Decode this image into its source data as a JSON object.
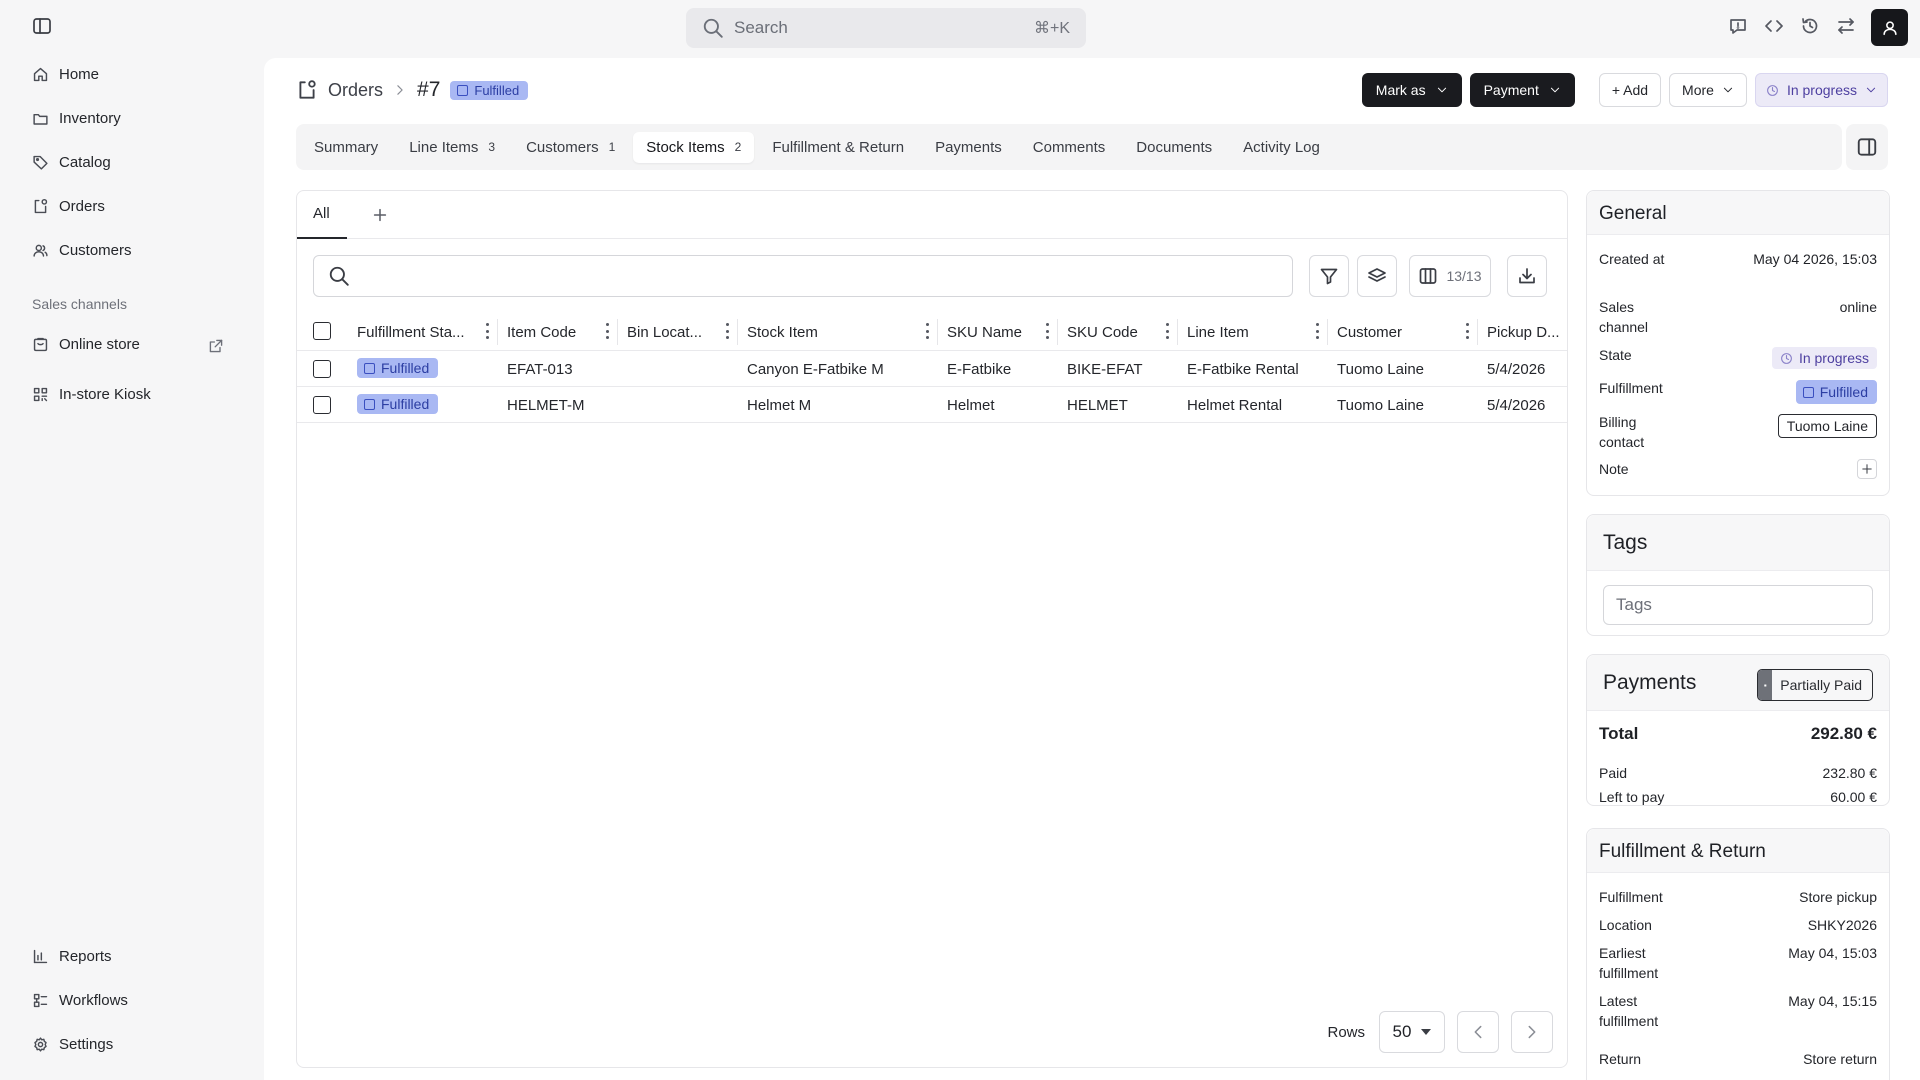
{
  "search": {
    "placeholder": "Search",
    "shortcut": "⌘+K"
  },
  "sidebar": {
    "items": [
      {
        "label": "Home",
        "icon": "home-icon"
      },
      {
        "label": "Inventory",
        "icon": "folder-icon"
      },
      {
        "label": "Catalog",
        "icon": "tag-icon"
      },
      {
        "label": "Orders",
        "icon": "orders-icon"
      },
      {
        "label": "Customers",
        "icon": "users-icon"
      }
    ],
    "section_label": "Sales channels",
    "channels": [
      {
        "label": "Online store",
        "icon": "store-icon"
      },
      {
        "label": "In-store Kiosk",
        "icon": "kiosk-icon"
      }
    ],
    "bottom": [
      {
        "label": "Reports",
        "icon": "chart-icon"
      },
      {
        "label": "Workflows",
        "icon": "workflow-icon"
      },
      {
        "label": "Settings",
        "icon": "gear-icon"
      }
    ]
  },
  "header": {
    "breadcrumb_root": "Orders",
    "order_id": "#7",
    "status": "Fulfilled",
    "actions": {
      "mark_as": "Mark as",
      "payment": "Payment",
      "add": "+ Add",
      "more": "More",
      "state": "In progress"
    }
  },
  "tabs": [
    {
      "label": "Summary",
      "count": ""
    },
    {
      "label": "Line Items",
      "count": "3"
    },
    {
      "label": "Customers",
      "count": "1"
    },
    {
      "label": "Stock Items",
      "count": "2",
      "active": true
    },
    {
      "label": "Fulfillment & Return",
      "count": ""
    },
    {
      "label": "Payments",
      "count": ""
    },
    {
      "label": "Comments",
      "count": ""
    },
    {
      "label": "Documents",
      "count": ""
    },
    {
      "label": "Activity Log",
      "count": ""
    }
  ],
  "table": {
    "view_tab": "All",
    "columns_count": "13/13",
    "columns": [
      "Fulfillment Sta...",
      "Item Code",
      "Bin Locat...",
      "Stock Item",
      "SKU Name",
      "SKU Code",
      "Line Item",
      "Customer",
      "Pickup D..."
    ],
    "rows": [
      {
        "status": "Fulfilled",
        "item_code": "EFAT-013",
        "bin": "",
        "stock_item": "Canyon E-Fatbike M",
        "sku_name": "E-Fatbike",
        "sku_code": "BIKE-EFAT",
        "line_item": "E-Fatbike Rental",
        "customer": "Tuomo Laine",
        "pickup": "5/4/2026"
      },
      {
        "status": "Fulfilled",
        "item_code": "HELMET-M",
        "bin": "",
        "stock_item": "Helmet M",
        "sku_name": "Helmet",
        "sku_code": "HELMET",
        "line_item": "Helmet Rental",
        "customer": "Tuomo Laine",
        "pickup": "5/4/2026"
      }
    ],
    "rows_label": "Rows",
    "rows_per_page": "50"
  },
  "general": {
    "title": "General",
    "created_label": "Created at",
    "created_value": "May 04 2026, 15:03",
    "channel_label": "Sales channel",
    "channel_value": "online",
    "state_label": "State",
    "state_value": "In progress",
    "fulfillment_label": "Fulfillment",
    "fulfillment_value": "Fulfilled",
    "billing_label": "Billing contact",
    "billing_value": "Tuomo Laine",
    "note_label": "Note"
  },
  "tags": {
    "title": "Tags",
    "placeholder": "Tags"
  },
  "payments": {
    "title": "Payments",
    "status": "Partially Paid",
    "total_label": "Total",
    "total_value": "292.80 €",
    "paid_label": "Paid",
    "paid_value": "232.80 €",
    "left_label": "Left to pay",
    "left_value": "60.00 €"
  },
  "fulfillment_return": {
    "title": "Fulfillment & Return",
    "fulfillment_label": "Fulfillment",
    "fulfillment_value": "Store pickup",
    "location_label": "Location",
    "location_value": "SHKY2026",
    "earliest_label": "Earliest fulfillment",
    "earliest_value": "May 04, 15:03",
    "latest_label": "Latest fulfillment",
    "latest_value": "May 04, 15:15",
    "return_label": "Return",
    "return_value": "Store return"
  }
}
